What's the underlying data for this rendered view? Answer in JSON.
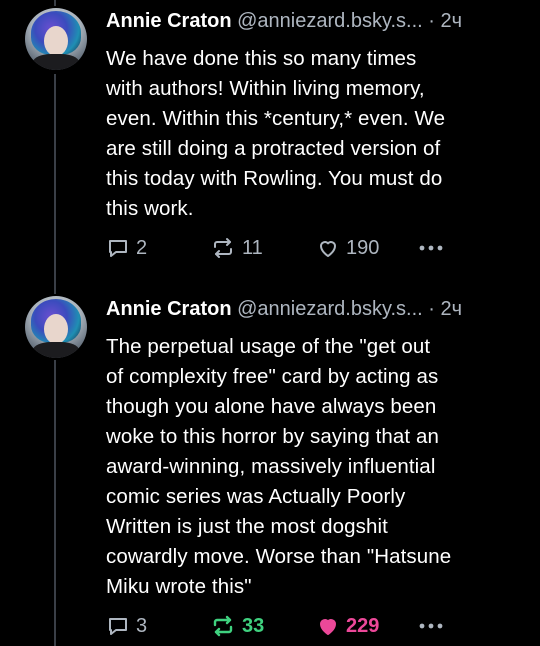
{
  "posts": [
    {
      "author_name": "Annie Craton",
      "handle": "@anniezard.bsky.s...",
      "separator": "·",
      "time": "2ч",
      "text": "We have done this so many times\nwith authors! Within living memory,\neven. Within this *century,* even. We\nare still doing a protracted version of\nthis today with Rowling. You must do\nthis work.",
      "reply_count": "2",
      "repost_count": "11",
      "like_count": "190",
      "reposted": false,
      "liked": false
    },
    {
      "author_name": "Annie Craton",
      "handle": "@anniezard.bsky.s...",
      "separator": "·",
      "time": "2ч",
      "text": "The perpetual usage of the \"get out\nof complexity free\" card by acting as\nthough you alone have always been\nwoke to this horror by saying that an\naward-winning, massively influential\ncomic series was Actually Poorly\nWritten is just the most dogshit\ncowardly move. Worse than \"Hatsune\nMiku wrote this\"",
      "reply_count": "3",
      "repost_count": "33",
      "like_count": "229",
      "reposted": true,
      "liked": true
    }
  ],
  "colors": {
    "background": "#000000",
    "text": "#ffffff",
    "muted": "#aeb6c0",
    "repost_active": "#3fd17f",
    "like_active": "#ec4899"
  },
  "icons": [
    "reply-icon",
    "repost-icon",
    "like-icon",
    "more-icon"
  ]
}
